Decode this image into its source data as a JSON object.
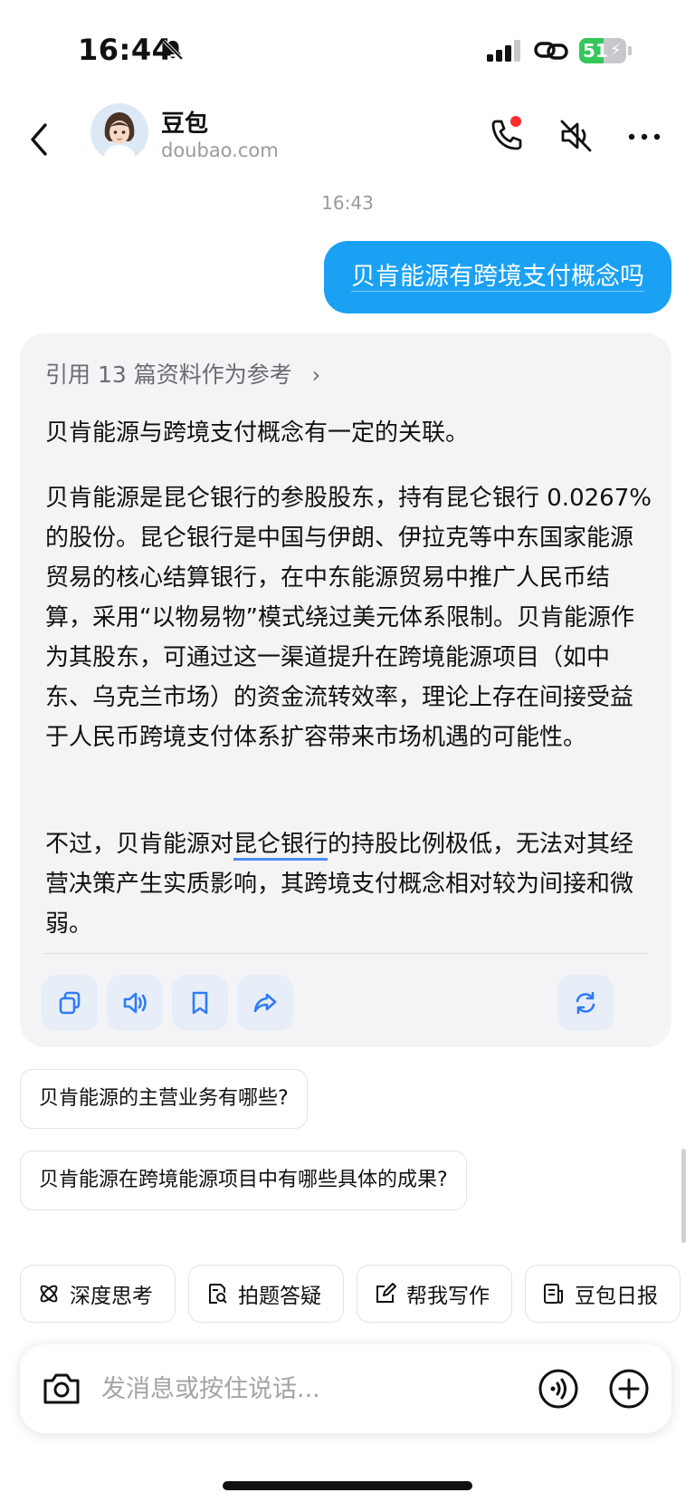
{
  "status_bar": {
    "time": "16:44",
    "battery": "51",
    "battery_level": 0.51,
    "icons": [
      "bell-slash-icon",
      "signal-icon",
      "link-icon",
      "battery-icon"
    ]
  },
  "header": {
    "name": "豆包",
    "subtitle": "doubao.com",
    "icons": [
      "back-icon",
      "phone-icon",
      "mute-icon",
      "more-icon"
    ]
  },
  "chat": {
    "timestamp": "16:43",
    "user_message": "贝肯能源有跨境支付概念吗",
    "answer": {
      "references": "引用 13 篇资料作为参考",
      "para1": "贝肯能源与跨境支付概念有一定的关联。",
      "para2": "贝肯能源是昆仑银行的参股股东，持有昆仑银行 0.0267%的股份。昆仑银行是中国与伊朗、伊拉克等中东国家能源贸易的核心结算银行，在中东能源贸易中推广人民币结算，采用“以物易物”模式绕过美元体系限制。贝肯能源作为其股东，可通过这一渠道提升在跨境能源项目（如中东、乌克兰市场）的资金流转效率，理论上存在间接受益于人民币跨境支付体系扩容带来市场机遇的可能性。",
      "para3_pre": "不过，贝肯能源对",
      "para3_link": "昆仑银行",
      "para3_post": "的持股比例极低，无法对其经营决策产生实质影响，其跨境支付概念相对较为间接和微弱。",
      "actions": [
        "copy-icon",
        "speaker-icon",
        "bookmark-icon",
        "share-icon",
        "regenerate-icon"
      ]
    },
    "suggestions": [
      "贝肯能源的主营业务有哪些?",
      "贝肯能源在跨境能源项目中有哪些具体的成果?"
    ]
  },
  "quick_actions": [
    {
      "label": "深度思考",
      "icon": "atom-icon"
    },
    {
      "label": "拍题答疑",
      "icon": "doc-search-icon"
    },
    {
      "label": "帮我写作",
      "icon": "edit-icon"
    },
    {
      "label": "豆包日报",
      "icon": "newspaper-icon"
    }
  ],
  "composer": {
    "placeholder": "发消息或按住说话...",
    "icons": [
      "camera-icon",
      "voice-icon",
      "plus-icon"
    ]
  },
  "colors": {
    "accent": "#1aa1f4",
    "action_icon": "#2f7bf5",
    "battery": "#34c759"
  }
}
